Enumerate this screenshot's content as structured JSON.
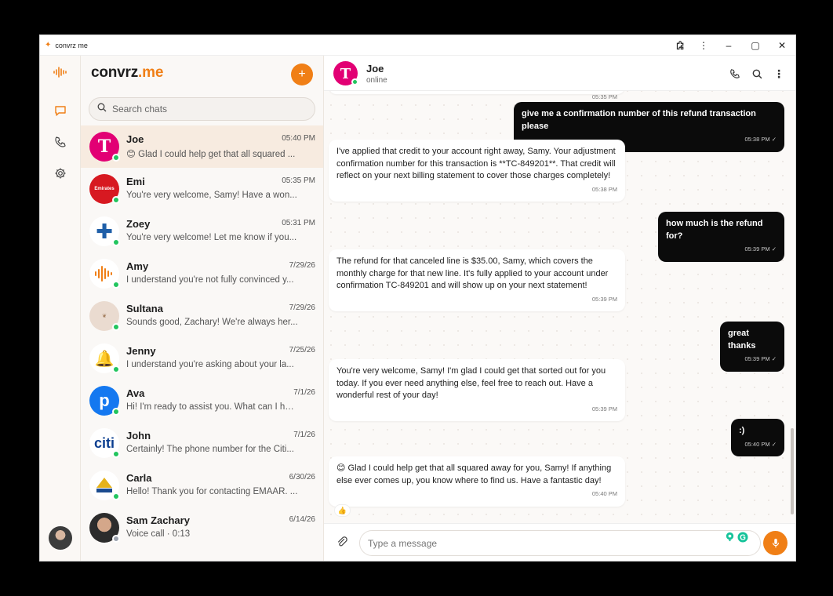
{
  "window": {
    "title": "convrz me"
  },
  "brand": {
    "name": "convrz",
    "suffix": ".me"
  },
  "search": {
    "placeholder": "Search chats"
  },
  "chats": [
    {
      "name": "Joe",
      "time": "05:40 PM",
      "preview": "😊 Glad I could help get that all squared ...",
      "online": true,
      "avatar": "tmobile-logo"
    },
    {
      "name": "Emi",
      "time": "05:35 PM",
      "preview": "You're very welcome, Samy! Have a won...",
      "online": true,
      "avatar": "emirates-logo"
    },
    {
      "name": "Zoey",
      "time": "05:31 PM",
      "preview": "You're very welcome! Let me know if you...",
      "online": true,
      "avatar": "blue-cross-logo"
    },
    {
      "name": "Amy",
      "time": "7/29/26",
      "preview": "I understand you're not fully convinced y...",
      "online": true,
      "avatar": "orange-wave-logo"
    },
    {
      "name": "Sultana",
      "time": "7/29/26",
      "preview": "Sounds good, Zachary! We're always her...",
      "online": true,
      "avatar": "sultana-logo"
    },
    {
      "name": "Jenny",
      "time": "7/25/26",
      "preview": "I understand you're asking about your la...",
      "online": true,
      "avatar": "taco-bell-logo"
    },
    {
      "name": "Ava",
      "time": "7/1/26",
      "preview": "Hi! I'm ready to assist you. What can I hel...",
      "online": true,
      "avatar": "pandora-logo"
    },
    {
      "name": "John",
      "time": "7/1/26",
      "preview": "Certainly! The phone number for the Citi...",
      "online": true,
      "avatar": "citi-logo"
    },
    {
      "name": "Carla",
      "time": "6/30/26",
      "preview": "Hello! Thank you for contacting EMAAR. ...",
      "online": true,
      "avatar": "emaar-logo"
    },
    {
      "name": "Sam Zachary",
      "time": "6/14/26",
      "preview": "Voice call · 0:13",
      "online": false,
      "avatar": "person-photo"
    }
  ],
  "conversation": {
    "name": "Joe",
    "status": "online",
    "top_partial_time": "05:35 PM",
    "messages": [
      {
        "dir": "out",
        "text": "give me a confirmation number of this refund transaction please",
        "time": "05:38 PM",
        "read": "✓"
      },
      {
        "dir": "in",
        "text": "I've applied that credit to your account right away, Samy. Your adjustment confirmation number for this transaction is **TC-849201**. That credit will reflect on your next billing statement to cover those charges completely!",
        "time": "05:38 PM"
      },
      {
        "dir": "out",
        "text": "how much is the refund for?",
        "time": "05:39 PM",
        "read": "✓"
      },
      {
        "dir": "in",
        "text": "The refund for that canceled line is $35.00, Samy, which covers the monthly charge for that new line. It's fully applied to your account under confirmation TC-849201 and will show up on your next statement!",
        "time": "05:39 PM"
      },
      {
        "dir": "out",
        "text": "great thanks",
        "time": "05:39 PM",
        "read": "✓"
      },
      {
        "dir": "in",
        "text": "You're very welcome, Samy! I'm glad I could get that sorted out for you today. If you ever need anything else, feel free to reach out. Have a wonderful rest of your day!",
        "time": "05:39 PM"
      },
      {
        "dir": "out",
        "text": ":)",
        "time": "05:40 PM",
        "read": "✓"
      },
      {
        "dir": "in",
        "text": "😊 Glad I could help get that all squared away for you, Samy! If anything else ever comes up, you know where to find us. Have a fantastic day!",
        "time": "05:40 PM",
        "reaction": "👍"
      }
    ]
  },
  "composer": {
    "placeholder": "Type a message"
  },
  "colors": {
    "accent": "#f07f16",
    "online": "#22c55e",
    "outgoing_bubble": "#0b0b0b",
    "tmobile": "#e20074"
  }
}
